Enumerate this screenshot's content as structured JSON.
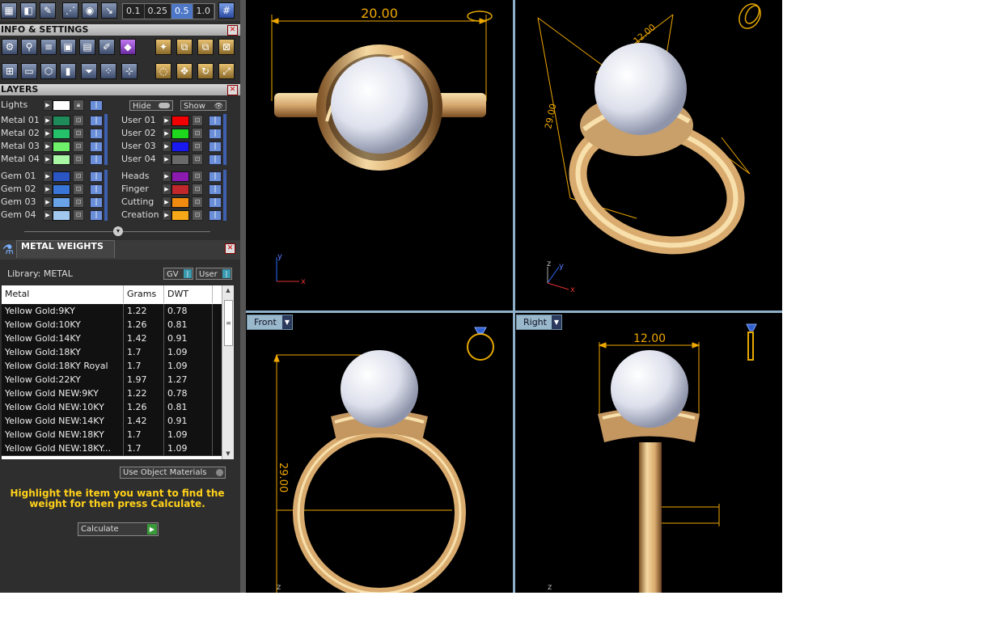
{
  "toolbar": {
    "zoom_values": [
      "0.1",
      "0.25",
      "0.5",
      "1.0"
    ],
    "zoom_selected": "0.5"
  },
  "info_settings": {
    "title": "INFO & SETTINGS"
  },
  "layers": {
    "title": "LAYERS",
    "lights_label": "Lights",
    "hide_label": "Hide",
    "show_label": "Show",
    "left_groups": [
      [
        {
          "name": "Metal 01",
          "color": "#1f8a5a"
        },
        {
          "name": "Metal 02",
          "color": "#24c06a"
        },
        {
          "name": "Metal 03",
          "color": "#6ef06a"
        },
        {
          "name": "Metal 04",
          "color": "#a9f7a4"
        }
      ],
      [
        {
          "name": "Gem 01",
          "color": "#2c55c4"
        },
        {
          "name": "Gem 02",
          "color": "#3a75d8"
        },
        {
          "name": "Gem 03",
          "color": "#6aa2e8"
        },
        {
          "name": "Gem 04",
          "color": "#a2c8f0"
        }
      ]
    ],
    "right_groups": [
      [
        {
          "name": "User 01",
          "color": "#f00000"
        },
        {
          "name": "User 02",
          "color": "#1ed81e"
        },
        {
          "name": "User 03",
          "color": "#1a1af0"
        },
        {
          "name": "User 04",
          "color": "#6a6a6a"
        }
      ],
      [
        {
          "name": "Heads",
          "color": "#8a1ab0"
        },
        {
          "name": "Finger",
          "color": "#c0282c"
        },
        {
          "name": "Cutting",
          "color": "#f08a10"
        },
        {
          "name": "Creation",
          "color": "#f5a818"
        }
      ]
    ]
  },
  "metal_weights": {
    "title": "METAL WEIGHTS",
    "library_label": "Library: METAL",
    "gv_label": "GV",
    "user_label": "User",
    "columns": [
      "Metal",
      "Grams",
      "DWT"
    ],
    "rows": [
      [
        "Yellow Gold:9KY",
        "1.22",
        "0.78"
      ],
      [
        "Yellow Gold:10KY",
        "1.26",
        "0.81"
      ],
      [
        "Yellow Gold:14KY",
        "1.42",
        "0.91"
      ],
      [
        "Yellow Gold:18KY",
        "1.7",
        "1.09"
      ],
      [
        "Yellow Gold:18KY Royal",
        "1.7",
        "1.09"
      ],
      [
        "Yellow Gold:22KY",
        "1.97",
        "1.27"
      ],
      [
        "Yellow Gold NEW:9KY",
        "1.22",
        "0.78"
      ],
      [
        "Yellow Gold NEW:10KY",
        "1.26",
        "0.81"
      ],
      [
        "Yellow Gold NEW:14KY",
        "1.42",
        "0.91"
      ],
      [
        "Yellow Gold NEW:18KY",
        "1.7",
        "1.09"
      ],
      [
        "Yellow Gold NEW:18KY...",
        "1.7",
        "1.09"
      ]
    ],
    "use_object_materials": "Use Object Materials",
    "instruction": "Highlight the item you want to find the weight for then press Calculate.",
    "calculate_label": "Calculate"
  },
  "viewports": {
    "top": {
      "dimension": "20.00",
      "axis_x": "x",
      "axis_y": "y"
    },
    "perspective": {
      "dimension_a": "12.00",
      "dimension_b": "29.00",
      "axis_x": "x",
      "axis_y": "y",
      "axis_z": "z"
    },
    "front": {
      "label": "Front",
      "dimension": "29.00",
      "axis_z": "z"
    },
    "right": {
      "label": "Right",
      "dimension": "12.00",
      "axis_z": "z"
    }
  },
  "colors": {
    "gold_light": "#f5d9a2",
    "gold_mid": "#d9ab6e",
    "gold_dark": "#8a5a2a",
    "pearl_light": "#ffffff",
    "pearl_shadow": "#aab0c4",
    "dimension": "#f0a800"
  }
}
